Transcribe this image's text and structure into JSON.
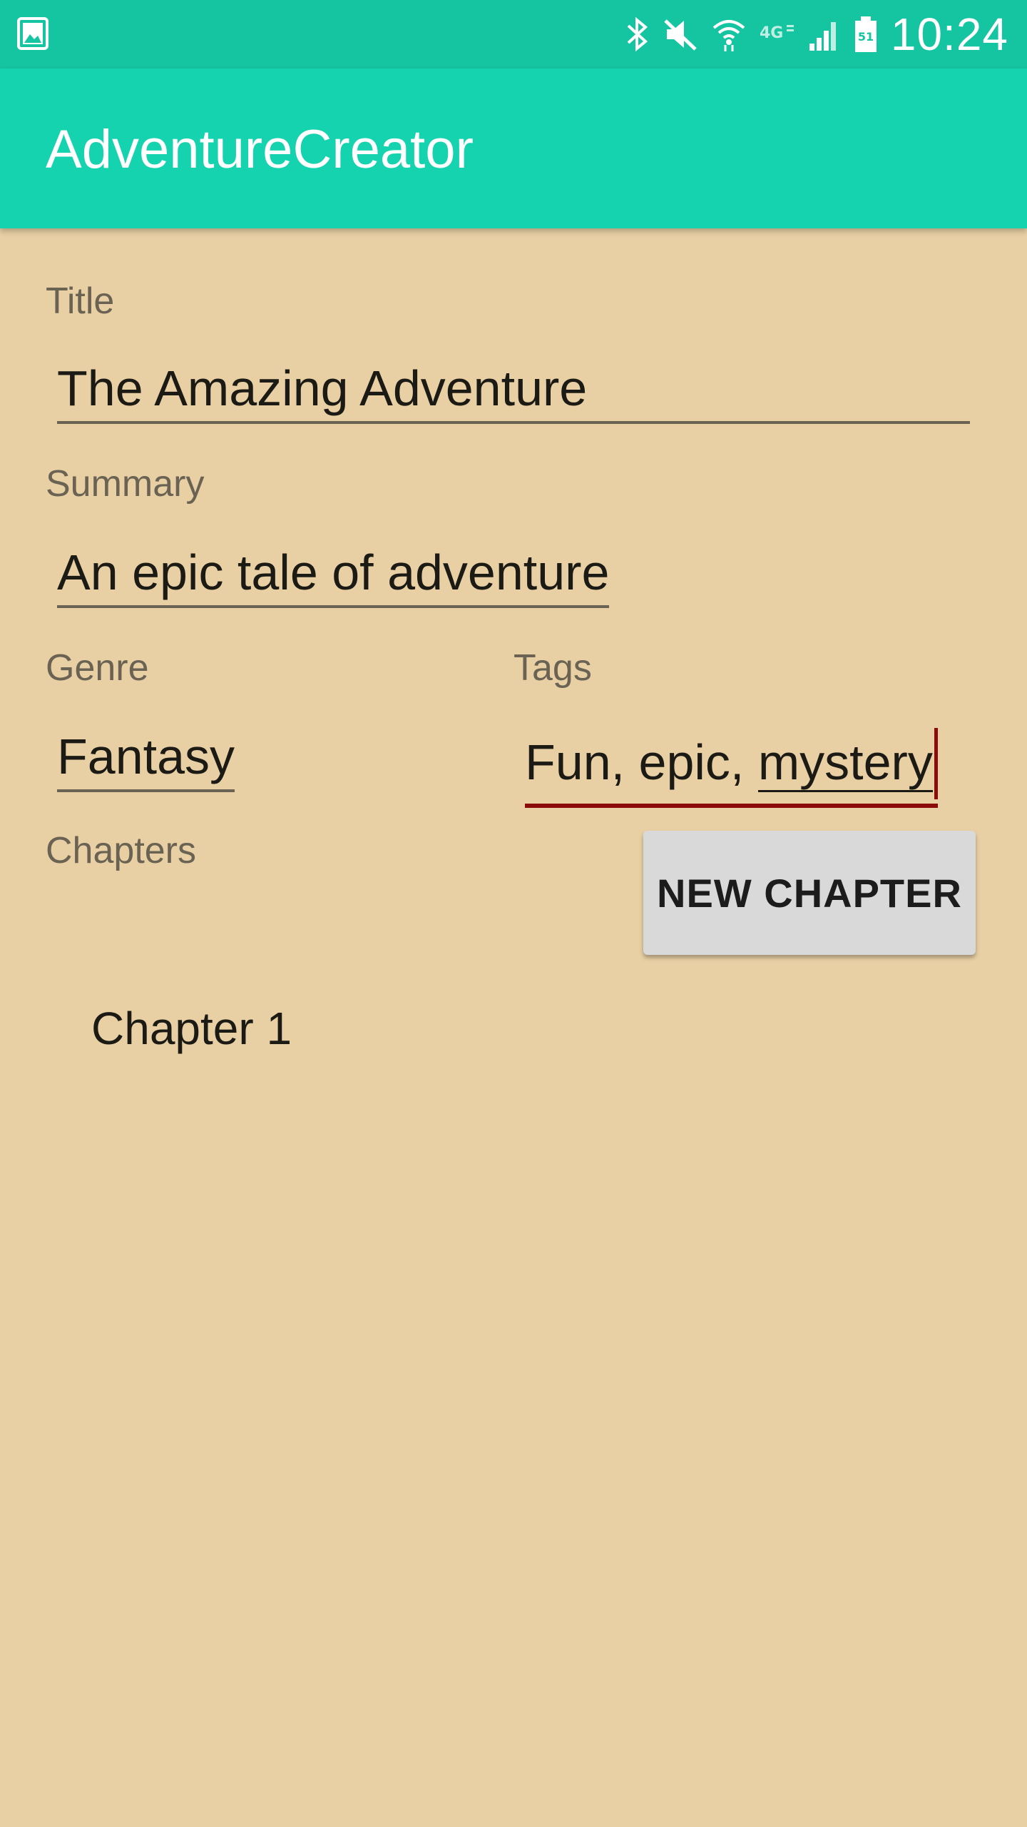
{
  "status_bar": {
    "time": "10:24",
    "battery_level": "51",
    "icons": [
      "gallery-icon",
      "bluetooth-icon",
      "mute-icon",
      "wifi-icon",
      "4g-lte-icon",
      "signal-icon",
      "battery-icon"
    ]
  },
  "app_bar": {
    "title": "AdventureCreator"
  },
  "form": {
    "title_label": "Title",
    "title_value": "The Amazing Adventure",
    "summary_label": "Summary",
    "summary_value": "An epic tale of adventure",
    "genre_label": "Genre",
    "genre_value": "Fantasy",
    "tags_label": "Tags",
    "tags_value_prefix": "Fun, epic, ",
    "tags_value_last_word": "mystery",
    "chapters_label": "Chapters"
  },
  "actions": {
    "new_chapter_label": "NEW CHAPTER"
  },
  "chapters": [
    {
      "title": "Chapter 1"
    }
  ],
  "colors": {
    "status_bar": "#15c4a1",
    "app_bar": "#15d3ae",
    "background": "#e8d0a4",
    "active_underline": "#8b0a0a",
    "button": "#d8d9d8"
  }
}
